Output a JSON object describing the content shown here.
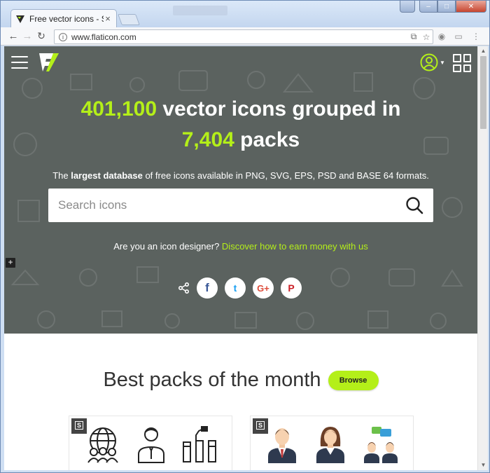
{
  "browser": {
    "tab_title": "Free vector icons - SVG",
    "tab_close": "×",
    "url": "www.flaticon.com",
    "info_icon": "i"
  },
  "header": {
    "menu_icon": "hamburger-icon",
    "logo": "flaticon-logo",
    "user_icon": "user-icon",
    "grid_icon": "grid-icon"
  },
  "hero": {
    "icon_count": "401,100",
    "line1_text": "vector icons grouped in",
    "pack_count": "7,404",
    "line2_text": "packs",
    "sub_prefix": "The",
    "sub_bold": "largest database",
    "sub_suffix": "of free icons available in PNG, SVG, EPS, PSD and BASE 64 formats.",
    "search_placeholder": "Search icons",
    "designer_question": "Are you an icon designer?",
    "designer_link": "Discover how to earn money with us"
  },
  "social": {
    "facebook": "f",
    "twitter": "t",
    "googleplus": "G+",
    "pinterest": "P"
  },
  "side_tab": "+",
  "best": {
    "title": "Best packs of the month",
    "browse_label": "Browse"
  },
  "packs": [
    {
      "badge": "S"
    },
    {
      "badge": "S"
    }
  ],
  "colors": {
    "accent": "#b4ef19",
    "hero_bg": "#5b625f"
  }
}
